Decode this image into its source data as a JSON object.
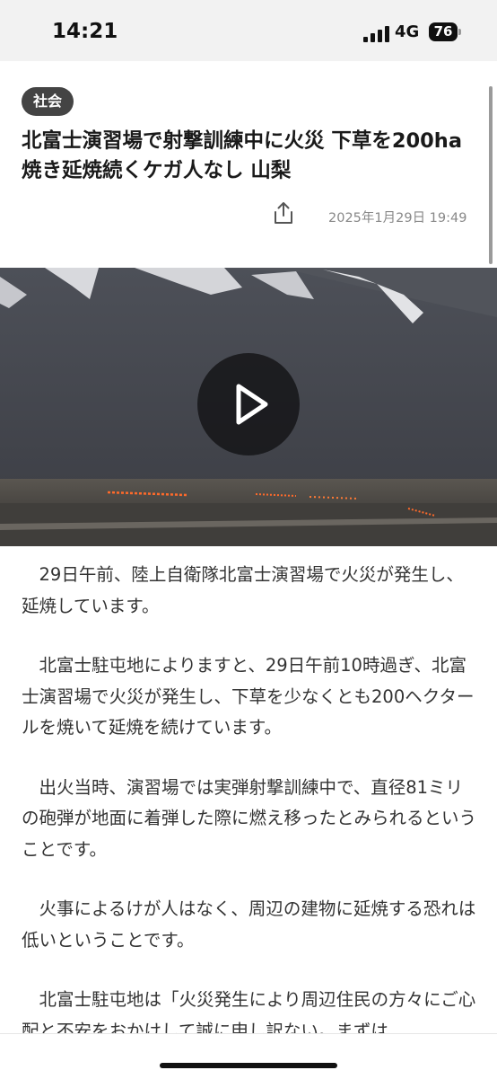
{
  "status_bar": {
    "time": "14:21",
    "network": "4G",
    "battery": "76"
  },
  "article": {
    "category": "社会",
    "title": "北富士演習場で射撃訓練中に火災 下草を200ha焼き延焼続くケガ人なし 山梨",
    "published": "2025年1月29日 19:49",
    "paragraphs": [
      "29日午前、陸上自衛隊北富士演習場で火災が発生し、延焼しています。",
      "北富士駐屯地によりますと、29日午前10時過ぎ、北富士演習場で火災が発生し、下草を少なくとも200ヘクタールを焼いて延焼を続けています。",
      "出火当時、演習場では実弾射撃訓練中で、直径81ミリの砲弾が地面に着弾した際に燃え移ったとみられるということです。",
      "火事によるけが人はなく、周辺の建物に延焼する恐れは低いということです。",
      "北富士駐屯地は「火災発生により周辺住民の方々にご心配と不安をおかけして誠に申し訳ない。まずは"
    ]
  },
  "icons": {
    "share": "share-icon",
    "play": "play-icon"
  },
  "colors": {
    "category_bg": "#444444",
    "play_bg": "#141416",
    "fire": "#ff6a2a"
  }
}
